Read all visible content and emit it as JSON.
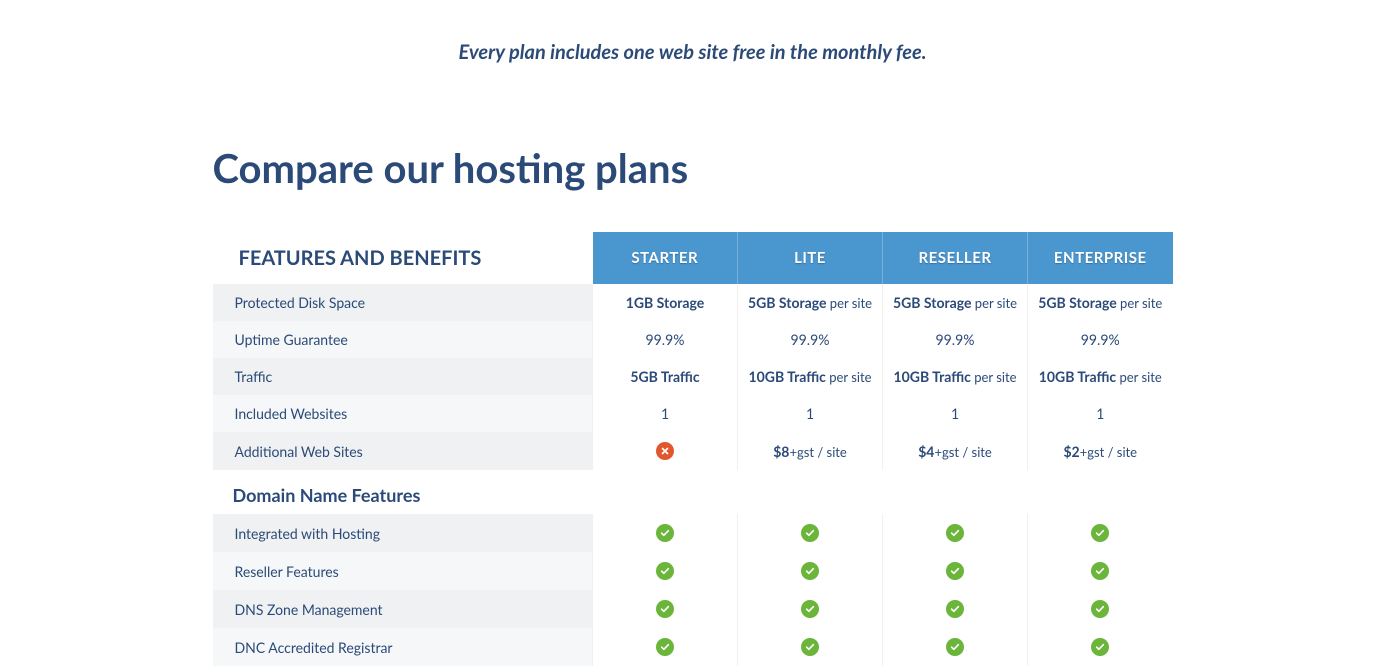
{
  "tagline": "Every plan includes one web site free in the monthly fee.",
  "heading": "Compare our hosting plans",
  "features_header": "FEATURES AND BENEFITS",
  "plans": [
    "STARTER",
    "LITE",
    "RESELLER",
    "ENTERPRISE"
  ],
  "rows": [
    {
      "label": "Protected Disk Space",
      "cells": [
        {
          "bold": "1GB Storage"
        },
        {
          "bold": "5GB Storage",
          "suffix": " per site"
        },
        {
          "bold": "5GB Storage",
          "suffix": " per site"
        },
        {
          "bold": "5GB Storage",
          "suffix": " per site"
        }
      ]
    },
    {
      "label": "Uptime Guarantee",
      "cells": [
        {
          "text": "99.9%"
        },
        {
          "text": "99.9%"
        },
        {
          "text": "99.9%"
        },
        {
          "text": "99.9%"
        }
      ]
    },
    {
      "label": "Traffic",
      "cells": [
        {
          "bold": "5GB Traffic"
        },
        {
          "bold": "10GB Traffic",
          "suffix": " per site"
        },
        {
          "bold": "10GB Traffic",
          "suffix": " per site"
        },
        {
          "bold": "10GB Traffic",
          "suffix": " per site"
        }
      ]
    },
    {
      "label": "Included Websites",
      "cells": [
        {
          "text": "1"
        },
        {
          "text": "1"
        },
        {
          "text": "1"
        },
        {
          "text": "1"
        }
      ]
    },
    {
      "label": "Additional Web Sites",
      "cells": [
        {
          "icon": "no"
        },
        {
          "bold": "$8",
          "suffix": "+gst / site"
        },
        {
          "bold": "$4",
          "suffix": "+gst / site"
        },
        {
          "bold": "$2",
          "suffix": "+gst / site"
        }
      ]
    }
  ],
  "section_title": "Domain Name Features",
  "section_rows": [
    {
      "label": "Integrated with Hosting",
      "cells": [
        {
          "icon": "yes"
        },
        {
          "icon": "yes"
        },
        {
          "icon": "yes"
        },
        {
          "icon": "yes"
        }
      ]
    },
    {
      "label": "Reseller Features",
      "cells": [
        {
          "icon": "yes"
        },
        {
          "icon": "yes"
        },
        {
          "icon": "yes"
        },
        {
          "icon": "yes"
        }
      ]
    },
    {
      "label": "DNS Zone Management",
      "cells": [
        {
          "icon": "yes"
        },
        {
          "icon": "yes"
        },
        {
          "icon": "yes"
        },
        {
          "icon": "yes"
        }
      ]
    },
    {
      "label": "DNC Accredited Registrar",
      "cells": [
        {
          "icon": "yes"
        },
        {
          "icon": "yes"
        },
        {
          "icon": "yes"
        },
        {
          "icon": "yes"
        }
      ]
    }
  ]
}
